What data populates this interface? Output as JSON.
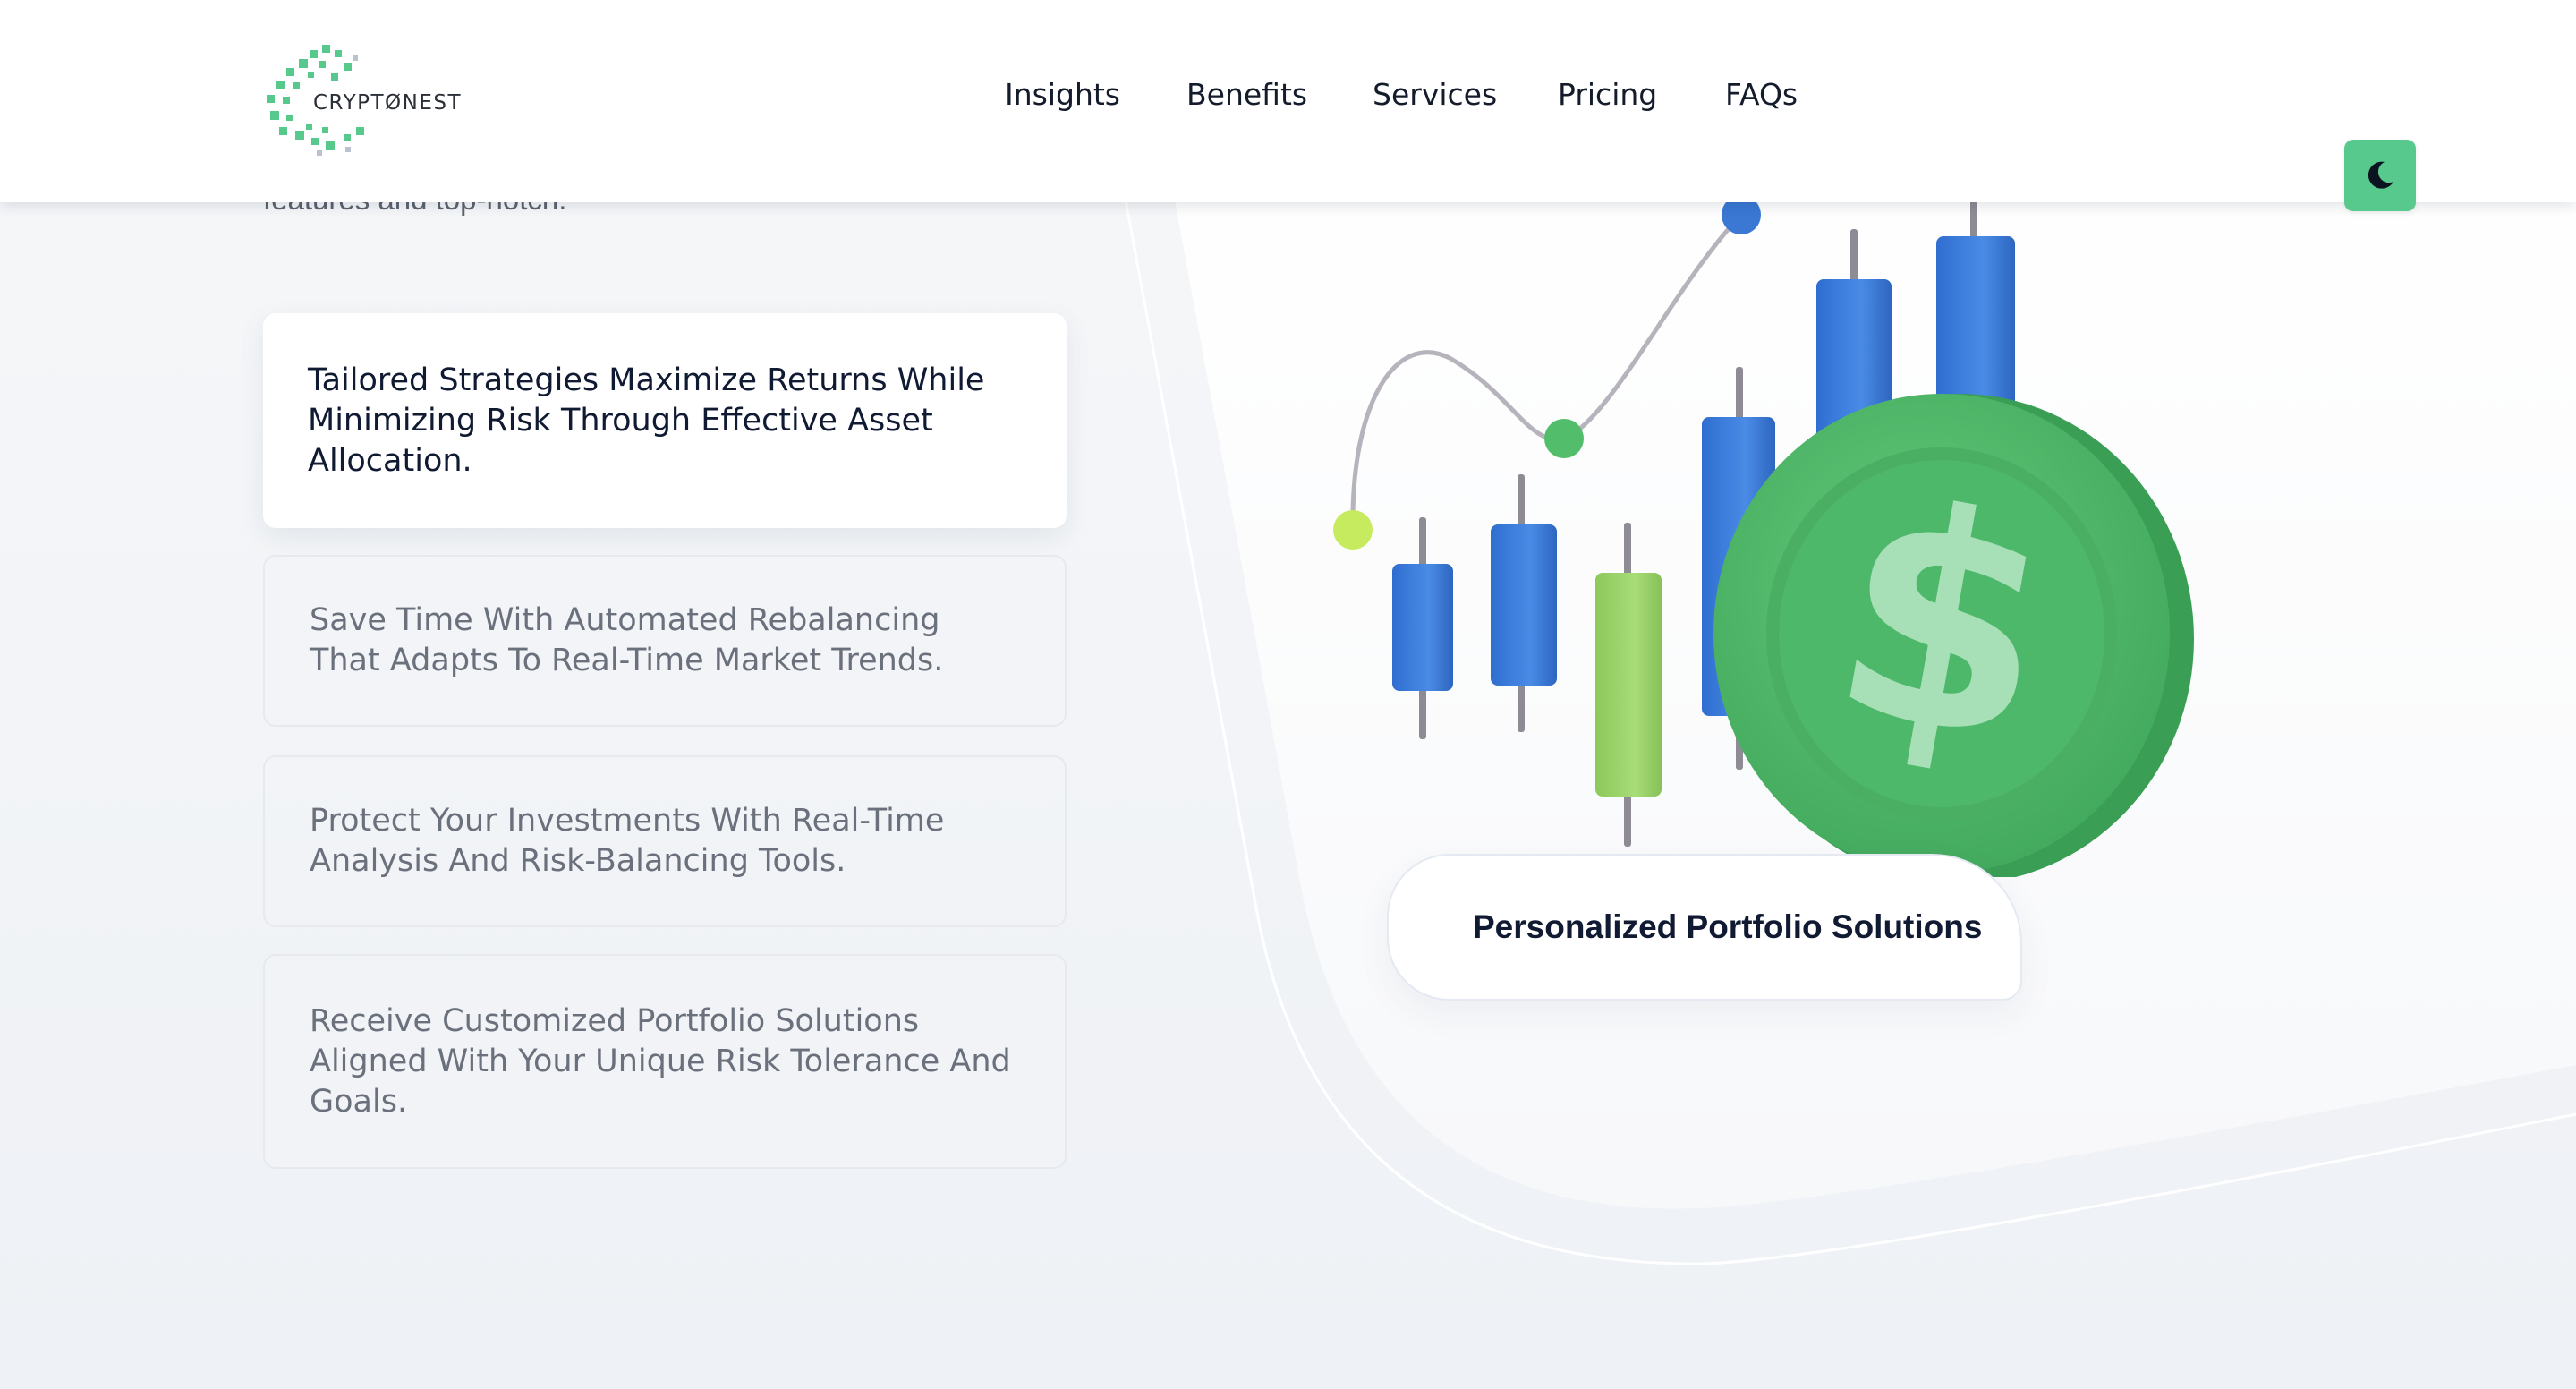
{
  "brand": {
    "name": "CRYPTØNEST",
    "accent_color": "#58c98d"
  },
  "nav": {
    "items": [
      {
        "label": "Insights"
      },
      {
        "label": "Benefits"
      },
      {
        "label": "Services"
      },
      {
        "label": "Pricing"
      },
      {
        "label": "FAQs"
      }
    ]
  },
  "theme_toggle": {
    "icon": "moon-icon"
  },
  "intro": {
    "cut_text": "features and top-notch."
  },
  "features": [
    {
      "text": "Tailored Strategies Maximize Returns While Minimizing Risk Through Effective Asset Allocation.",
      "active": true
    },
    {
      "text": "Save Time With Automated Rebalancing That Adapts To Real-Time Market Trends.",
      "active": false
    },
    {
      "text": "Protect Your Investments With Real-Time Analysis And Risk-Balancing Tools.",
      "active": false
    },
    {
      "text": "Receive Customized Portfolio Solutions Aligned With Your Unique Risk Tolerance And Goals.",
      "active": false
    }
  ],
  "illustration": {
    "caption": "Personalized Portfolio Solutions",
    "coin_symbol": "$",
    "colors": {
      "candle_blue": "#3a78d4",
      "candle_green": "#9bd46a",
      "coin_green": "#4db86a"
    }
  }
}
